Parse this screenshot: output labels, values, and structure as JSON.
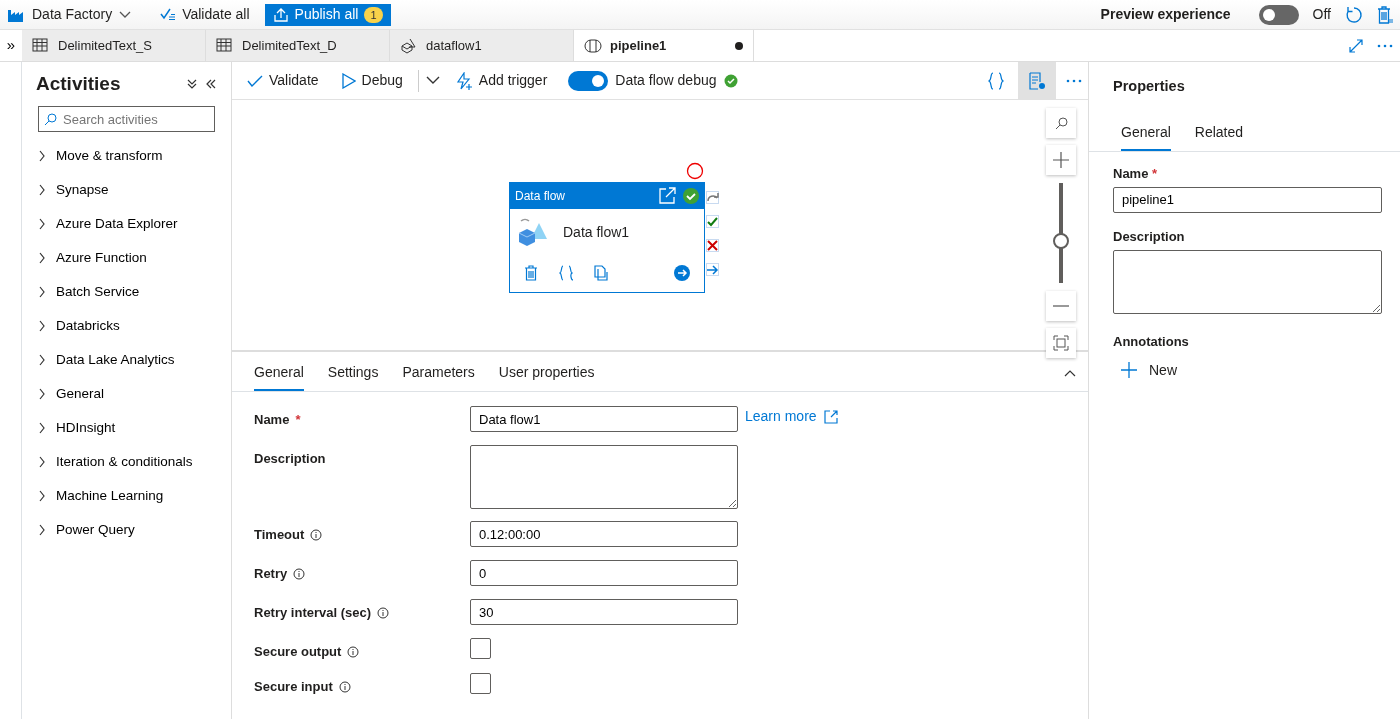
{
  "header": {
    "title": "Data Factory",
    "validate_all": "Validate all",
    "publish_all": "Publish all",
    "publish_count": "1",
    "preview_label": "Preview experience",
    "preview_toggle": {
      "on": false,
      "label": "Off"
    }
  },
  "sidebar_toggle": "»",
  "tabs": [
    {
      "label": "DelimitedText_S",
      "kind": "dataset",
      "selected": false,
      "unsaved": false
    },
    {
      "label": "DelimitedText_D",
      "kind": "dataset",
      "selected": false,
      "unsaved": false
    },
    {
      "label": "dataflow1",
      "kind": "dataflow",
      "selected": false,
      "unsaved": false
    },
    {
      "label": "pipeline1",
      "kind": "pipeline",
      "selected": true,
      "unsaved": true
    }
  ],
  "sidebar": {
    "title": "Activities",
    "search_placeholder": "Search activities",
    "items": [
      {
        "label": "Move & transform",
        "expanded": false
      },
      {
        "label": "Synapse",
        "expanded": false
      },
      {
        "label": "Azure Data Explorer",
        "expanded": false
      },
      {
        "label": "Azure Function",
        "expanded": false
      },
      {
        "label": "Batch Service",
        "expanded": false
      },
      {
        "label": "Databricks",
        "expanded": false
      },
      {
        "label": "Data Lake Analytics",
        "expanded": false
      },
      {
        "label": "General",
        "expanded": false
      },
      {
        "label": "HDInsight",
        "expanded": false
      },
      {
        "label": "Iteration & conditionals",
        "expanded": false
      },
      {
        "label": "Machine Learning",
        "expanded": false
      },
      {
        "label": "Power Query",
        "expanded": false
      }
    ]
  },
  "toolbar": {
    "validate": "Validate",
    "debug": "Debug",
    "add_trigger": "Add trigger",
    "debug_toggle": {
      "on": true,
      "label": "Data flow debug"
    }
  },
  "canvas": {
    "activity": {
      "type": "Data flow",
      "name": "Data flow1"
    },
    "zoom": {
      "level": 0.42
    }
  },
  "bottom_panel": {
    "tabs": [
      {
        "label": "General",
        "selected": true
      },
      {
        "label": "Settings",
        "selected": false
      },
      {
        "label": "Parameters",
        "selected": false
      },
      {
        "label": "User properties",
        "selected": false
      }
    ],
    "learn_more": "Learn more",
    "fields": [
      {
        "kind": "text",
        "label": "Name",
        "required_mark": "*",
        "info": false,
        "value": "Data flow1"
      },
      {
        "kind": "textarea",
        "label": "Description",
        "info": false
      },
      {
        "kind": "text",
        "label": "Timeout",
        "info": true,
        "value": "0.12:00:00"
      },
      {
        "kind": "text",
        "label": "Retry",
        "info": true,
        "value": "0"
      },
      {
        "kind": "text",
        "label": "Retry interval (sec)",
        "info": true,
        "value": "30"
      },
      {
        "kind": "checkbox",
        "label": "Secure output",
        "info": true,
        "checked": false
      },
      {
        "kind": "checkbox",
        "label": "Secure input",
        "info": true,
        "checked": false
      }
    ]
  },
  "properties": {
    "title": "Properties",
    "tabs": [
      {
        "label": "General",
        "selected": true
      },
      {
        "label": "Related",
        "selected": false
      }
    ],
    "name_label": "Name",
    "name_required_mark": "*",
    "name_value": "pipeline1",
    "description_label": "Description",
    "annotations_label": "Annotations",
    "new_label": "New"
  }
}
